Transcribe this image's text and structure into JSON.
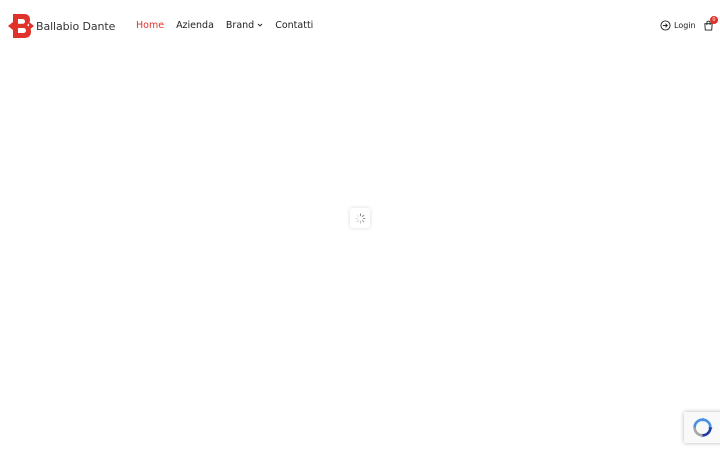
{
  "header": {
    "logo_text": "Ballabio Dante",
    "nav": [
      {
        "label": "Home",
        "active": true
      },
      {
        "label": "Azienda",
        "active": false
      },
      {
        "label": "Brand",
        "active": false,
        "has_dropdown": true
      },
      {
        "label": "Contatti",
        "active": false
      }
    ],
    "login_label": "Login",
    "cart_count": "0"
  },
  "icons": {
    "logo": "ballabio-dante-logo",
    "dropdown": "chevron-down-icon",
    "login": "login-icon",
    "cart": "shopping-bag-icon",
    "loader": "spinner-icon",
    "recaptcha": "recaptcha-icon"
  },
  "colors": {
    "accent": "#e0312b",
    "text": "#222222",
    "background": "#ffffff"
  }
}
